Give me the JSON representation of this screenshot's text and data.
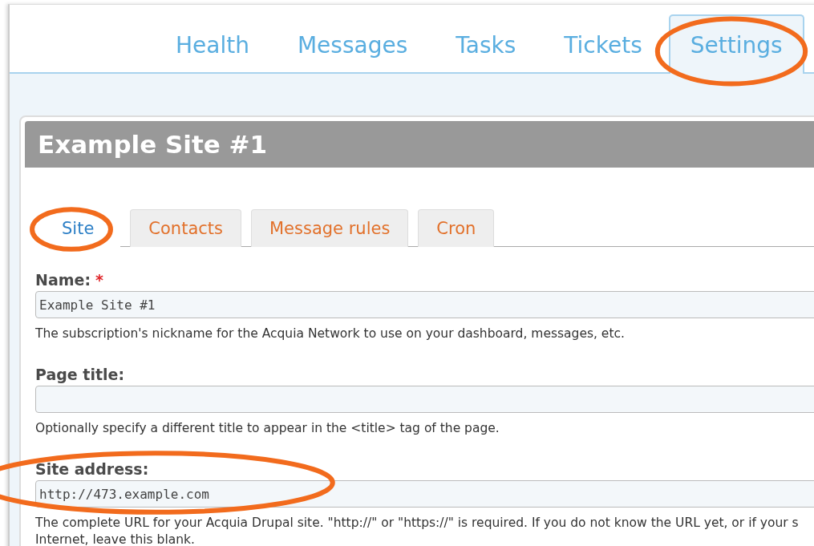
{
  "nav_tabs": [
    {
      "label": "Health",
      "selected": false,
      "circled": false
    },
    {
      "label": "Messages",
      "selected": false,
      "circled": false
    },
    {
      "label": "Tasks",
      "selected": false,
      "circled": false
    },
    {
      "label": "Tickets",
      "selected": false,
      "circled": false
    },
    {
      "label": "Settings",
      "selected": true,
      "circled": true
    }
  ],
  "site_title": "Example Site #1",
  "sub_tabs": [
    {
      "label": "Site",
      "selected": true,
      "circled": true
    },
    {
      "label": "Contacts",
      "selected": false,
      "circled": false
    },
    {
      "label": "Message rules",
      "selected": false,
      "circled": false
    },
    {
      "label": "Cron",
      "selected": false,
      "circled": false
    }
  ],
  "fields": [
    {
      "label": "Name:",
      "required_mark": "*",
      "value": "Example Site #1",
      "help": [
        "The subscription's nickname for the Acquia Network to use on your dashboard, messages, etc."
      ],
      "circled": false
    },
    {
      "label": "Page title:",
      "help": [
        "Optionally specify a different title to appear in the <title> tag of the page."
      ],
      "circled": false
    },
    {
      "label": "Site address:",
      "value": "http://473.example.com",
      "help": [
        "The complete URL for your Acquia Drupal site. \"http://\" or \"https://\" is required. If you do not know the URL yet, or if your s",
        "Internet, leave this blank."
      ],
      "circled": true
    }
  ]
}
